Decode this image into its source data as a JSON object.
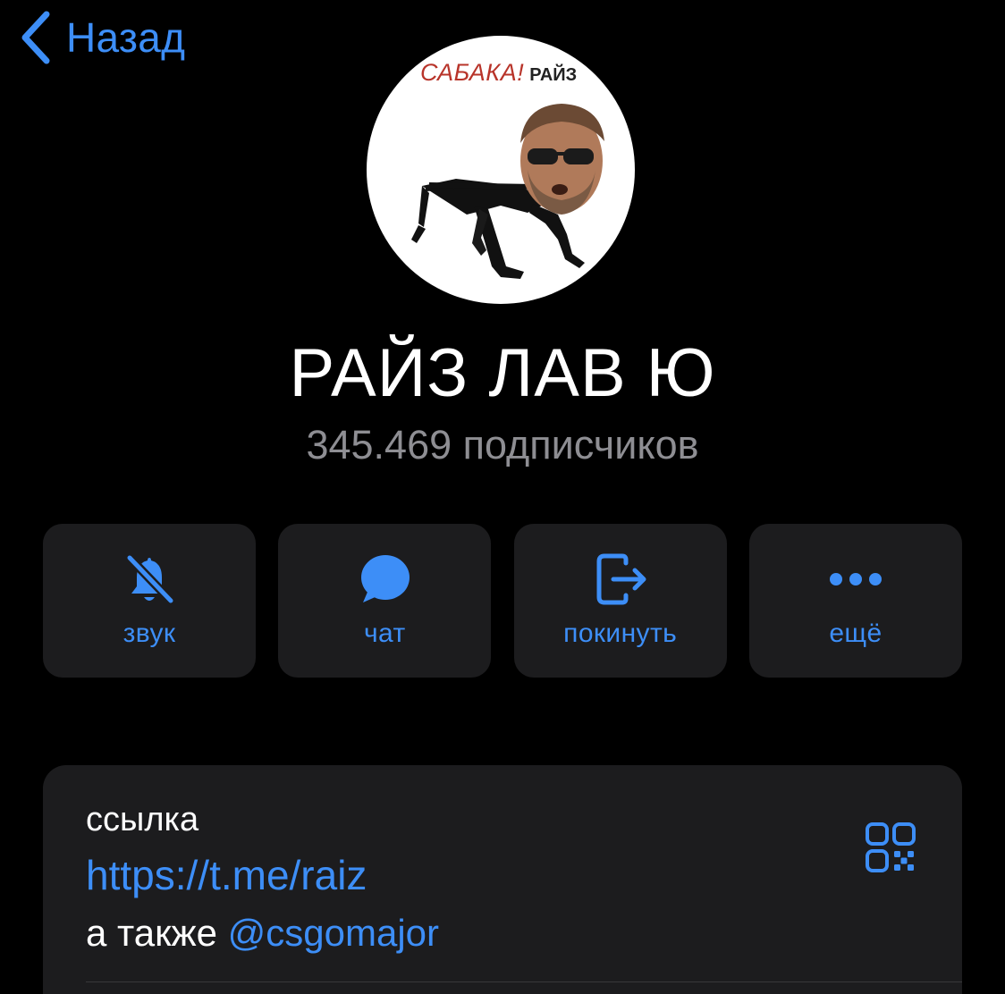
{
  "nav": {
    "back_label": "Назад"
  },
  "avatar": {
    "caption_main": "САБАКА!",
    "caption_small": "РАЙЗ"
  },
  "channel": {
    "title": "РАЙЗ ЛАВ Ю",
    "subscribers": "345.469 подписчиков"
  },
  "actions": [
    {
      "label": "звук",
      "icon": "bell-slash-icon"
    },
    {
      "label": "чат",
      "icon": "chat-bubble-icon"
    },
    {
      "label": "покинуть",
      "icon": "leave-icon"
    },
    {
      "label": "ещё",
      "icon": "more-icon"
    }
  ],
  "info": {
    "title": "ссылка",
    "link": "https://t.me/raiz",
    "extra_prefix": "а также ",
    "extra_mention": "@csgomajor",
    "qr_icon": "qr-code-icon"
  },
  "colors": {
    "accent": "#3d8ef7",
    "background": "#000000",
    "card": "#1c1c1e",
    "secondary_text": "#8e8e93"
  }
}
